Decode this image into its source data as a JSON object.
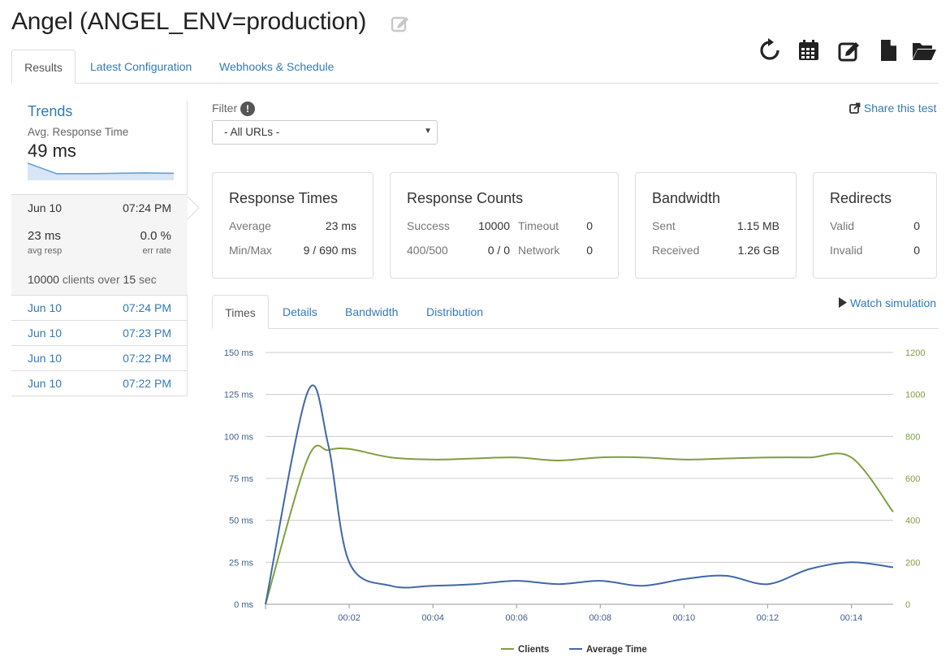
{
  "header": {
    "title": "Angel (ANGEL_ENV=production)"
  },
  "toolbar": {
    "icons": [
      "refresh-icon",
      "calendar-icon",
      "edit-icon",
      "file-icon",
      "folder-open-icon"
    ]
  },
  "tabs": [
    {
      "label": "Results",
      "active": true
    },
    {
      "label": "Latest Configuration",
      "active": false
    },
    {
      "label": "Webhooks & Schedule",
      "active": false
    }
  ],
  "sidebar": {
    "trends_title": "Trends",
    "trends_sub": "Avg. Response Time",
    "trends_value": "49 ms",
    "sparkline": [
      35,
      11,
      11,
      12,
      13,
      12
    ],
    "current": {
      "date": "Jun 10",
      "time": "07:24 PM",
      "resp": "23 ms",
      "resp_label": "avg resp",
      "err": "0.0 %",
      "err_label": "err rate",
      "clients": "10000",
      "over_word": "clients over",
      "duration": "15",
      "unit": "sec"
    },
    "runs": [
      {
        "date": "Jun 10",
        "time": "07:24 PM"
      },
      {
        "date": "Jun 10",
        "time": "07:23 PM"
      },
      {
        "date": "Jun 10",
        "time": "07:22 PM"
      },
      {
        "date": "Jun 10",
        "time": "07:22 PM"
      }
    ]
  },
  "filter": {
    "label": "Filter",
    "info": "!",
    "selected": "- All URLs -",
    "share": "Share this test"
  },
  "panels": {
    "response_times": {
      "title": "Response Times",
      "average_label": "Average",
      "average": "23 ms",
      "minmax_label": "Min/Max",
      "minmax": "9 / 690 ms"
    },
    "response_counts": {
      "title": "Response Counts",
      "success_label": "Success",
      "success": "10000",
      "timeout_label": "Timeout",
      "timeout": "0",
      "err_label": "400/500",
      "err": "0 / 0",
      "network_label": "Network",
      "network": "0"
    },
    "bandwidth": {
      "title": "Bandwidth",
      "sent_label": "Sent",
      "sent": "1.15 MB",
      "received_label": "Received",
      "received": "1.26 GB"
    },
    "redirects": {
      "title": "Redirects",
      "valid_label": "Valid",
      "valid": "0",
      "invalid_label": "Invalid",
      "invalid": "0"
    }
  },
  "chart_tabs": [
    {
      "label": "Times",
      "active": true
    },
    {
      "label": "Details",
      "active": false
    },
    {
      "label": "Bandwidth",
      "active": false
    },
    {
      "label": "Distribution",
      "active": false
    }
  ],
  "watch_label": "Watch simulation",
  "colors": {
    "clients": "#7f9f3f",
    "avg_time": "#3f67a8",
    "link": "#337ab7"
  },
  "chart_data": {
    "type": "line",
    "x_ticks": [
      "00:02",
      "00:04",
      "00:06",
      "00:08",
      "00:10",
      "00:12",
      "00:14"
    ],
    "x_tick_values": [
      2,
      4,
      6,
      8,
      10,
      12,
      14
    ],
    "xlim": [
      0,
      15
    ],
    "ylim_left": [
      0,
      150
    ],
    "ylim_right": [
      0,
      1200
    ],
    "y_left_ticks": [
      "0 ms",
      "25 ms",
      "50 ms",
      "75 ms",
      "100 ms",
      "125 ms",
      "150 ms"
    ],
    "y_left_values": [
      0,
      25,
      50,
      75,
      100,
      125,
      150
    ],
    "y_right_ticks": [
      "0",
      "200",
      "400",
      "600",
      "800",
      "1000",
      "1200"
    ],
    "y_right_values": [
      0,
      200,
      400,
      600,
      800,
      1000,
      1200
    ],
    "grid": true,
    "legend_position": "bottom",
    "series": [
      {
        "name": "Clients",
        "axis": "right",
        "x": [
          0,
          1,
          1.5,
          2,
          3,
          4,
          5,
          6,
          7,
          8,
          9,
          10,
          11,
          12,
          13,
          14,
          15
        ],
        "values": [
          0,
          690,
          735,
          740,
          700,
          690,
          695,
          700,
          685,
          700,
          700,
          690,
          695,
          700,
          700,
          700,
          440
        ]
      },
      {
        "name": "Average Time",
        "axis": "left",
        "x": [
          0,
          1,
          1.5,
          2,
          3,
          4,
          5,
          6,
          7,
          8,
          9,
          10,
          11,
          12,
          13,
          14,
          15
        ],
        "values": [
          0,
          126,
          95,
          25,
          11,
          11,
          12,
          14,
          12,
          14,
          11,
          15,
          17,
          12,
          21,
          25,
          22
        ]
      }
    ]
  }
}
